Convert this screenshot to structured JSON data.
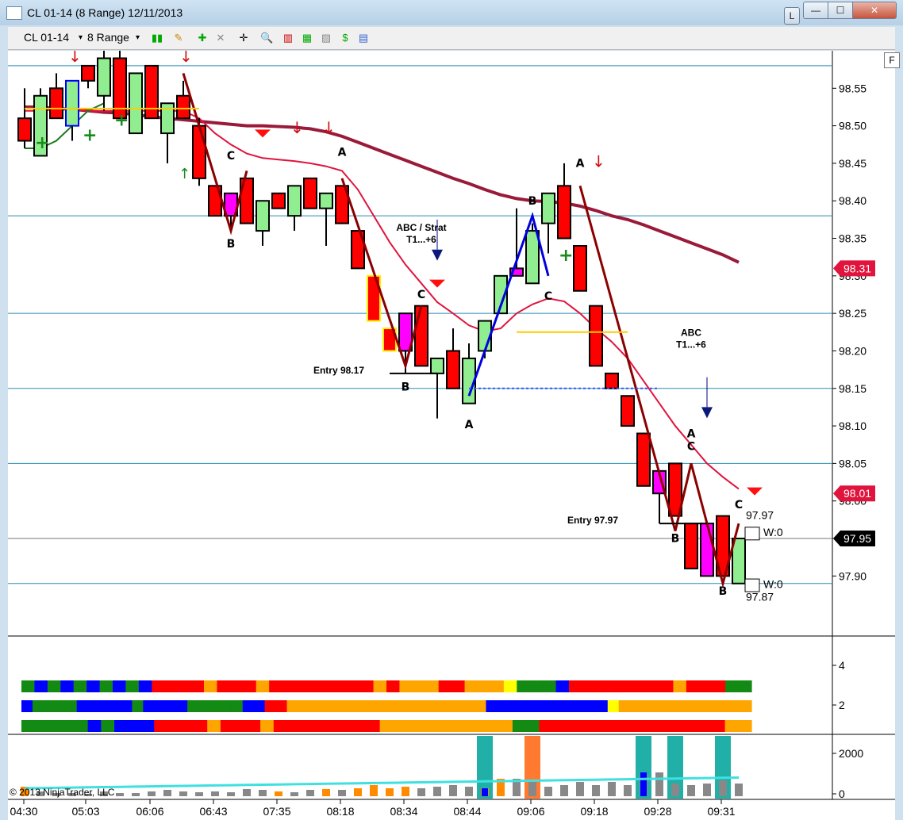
{
  "window": {
    "title": "CL 01-14 (8 Range)  12/11/2013",
    "buttons": {
      "l": "L",
      "min": "—",
      "max": "☐",
      "close": "✕"
    },
    "frame_color": "#b9d2e8"
  },
  "toolbar": {
    "instrument": "CL 01-14",
    "period": "8 Range",
    "icons": [
      "bar-style-icon",
      "pencil-draw-icon",
      "zoom-in-icon",
      "zoom-out-icon",
      "crosshair-icon",
      "magnifier-icon",
      "indicators-icon",
      "strategies-icon",
      "dollar-icon",
      "properties-icon"
    ]
  },
  "chart_data": {
    "type": "candlestick",
    "ylim": [
      97.82,
      98.6
    ],
    "yticks": [
      "98.55",
      "98.50",
      "98.45",
      "98.40",
      "98.35",
      "98.30",
      "98.25",
      "98.20",
      "98.15",
      "98.10",
      "98.05",
      "98.00",
      "97.95",
      "97.90"
    ],
    "xticks": [
      "04:30",
      "05:03",
      "06:06",
      "06:43",
      "07:35",
      "08:18",
      "08:34",
      "08:44",
      "09:06",
      "09:18",
      "09:28",
      "09:31"
    ],
    "price_labels": [
      {
        "text": "98.31",
        "value": 98.31,
        "color": "#e0143c"
      },
      {
        "text": "98.01",
        "value": 98.01,
        "color": "#e0143c"
      },
      {
        "text": "97.95",
        "value": 97.95,
        "color": "#000000"
      }
    ],
    "candles": [
      {
        "o": 98.48,
        "h": 98.55,
        "l": 98.47,
        "c": 98.51,
        "col": "red"
      },
      {
        "o": 98.46,
        "h": 98.55,
        "l": 98.46,
        "c": 98.54,
        "col": "green"
      },
      {
        "o": 98.55,
        "h": 98.57,
        "l": 98.51,
        "c": 98.51,
        "col": "red"
      },
      {
        "o": 98.5,
        "h": 98.56,
        "l": 98.48,
        "c": 98.56,
        "col": "green",
        "outline": "blue"
      },
      {
        "o": 98.58,
        "h": 98.58,
        "l": 98.55,
        "c": 98.56,
        "col": "red"
      },
      {
        "o": 98.54,
        "h": 98.6,
        "l": 98.52,
        "c": 98.59,
        "col": "green"
      },
      {
        "o": 98.59,
        "h": 98.6,
        "l": 98.51,
        "c": 98.51,
        "col": "red"
      },
      {
        "o": 98.49,
        "h": 98.57,
        "l": 98.49,
        "c": 98.57,
        "col": "green"
      },
      {
        "o": 98.58,
        "h": 98.58,
        "l": 98.51,
        "c": 98.51,
        "col": "red"
      },
      {
        "o": 98.49,
        "h": 98.53,
        "l": 98.45,
        "c": 98.53,
        "col": "green"
      },
      {
        "o": 98.54,
        "h": 98.56,
        "l": 98.51,
        "c": 98.51,
        "col": "red"
      },
      {
        "o": 98.5,
        "h": 98.51,
        "l": 98.42,
        "c": 98.43,
        "col": "red"
      },
      {
        "o": 98.42,
        "h": 98.42,
        "l": 98.38,
        "c": 98.38,
        "col": "red"
      },
      {
        "o": 98.38,
        "h": 98.41,
        "l": 98.36,
        "c": 98.41,
        "col": "magenta"
      },
      {
        "o": 98.43,
        "h": 98.43,
        "l": 98.37,
        "c": 98.37,
        "col": "red"
      },
      {
        "o": 98.36,
        "h": 98.4,
        "l": 98.34,
        "c": 98.4,
        "col": "green"
      },
      {
        "o": 98.41,
        "h": 98.41,
        "l": 98.39,
        "c": 98.39,
        "col": "red"
      },
      {
        "o": 98.38,
        "h": 98.42,
        "l": 98.36,
        "c": 98.42,
        "col": "green"
      },
      {
        "o": 98.43,
        "h": 98.43,
        "l": 98.39,
        "c": 98.39,
        "col": "red"
      },
      {
        "o": 98.39,
        "h": 98.41,
        "l": 98.34,
        "c": 98.41,
        "col": "green"
      },
      {
        "o": 98.42,
        "h": 98.42,
        "l": 98.37,
        "c": 98.37,
        "col": "red"
      },
      {
        "o": 98.36,
        "h": 98.36,
        "l": 98.31,
        "c": 98.31,
        "col": "red"
      },
      {
        "o": 98.3,
        "h": 98.3,
        "l": 98.24,
        "c": 98.24,
        "col": "red",
        "outline": "yellow"
      },
      {
        "o": 98.23,
        "h": 98.23,
        "l": 98.2,
        "c": 98.2,
        "col": "red",
        "outline": "yellow"
      },
      {
        "o": 98.2,
        "h": 98.25,
        "l": 98.17,
        "c": 98.25,
        "col": "magenta"
      },
      {
        "o": 98.26,
        "h": 98.26,
        "l": 98.18,
        "c": 98.18,
        "col": "red"
      },
      {
        "o": 98.17,
        "h": 98.19,
        "l": 98.11,
        "c": 98.19,
        "col": "green"
      },
      {
        "o": 98.2,
        "h": 98.23,
        "l": 98.15,
        "c": 98.15,
        "col": "red"
      },
      {
        "o": 98.13,
        "h": 98.21,
        "l": 98.13,
        "c": 98.19,
        "col": "green"
      },
      {
        "o": 98.2,
        "h": 98.24,
        "l": 98.19,
        "c": 98.24,
        "col": "green"
      },
      {
        "o": 98.25,
        "h": 98.3,
        "l": 98.25,
        "c": 98.3,
        "col": "green"
      },
      {
        "o": 98.3,
        "h": 98.39,
        "l": 98.3,
        "c": 98.31,
        "col": "magenta"
      },
      {
        "o": 98.29,
        "h": 98.37,
        "l": 98.29,
        "c": 98.36,
        "col": "green"
      },
      {
        "o": 98.37,
        "h": 98.41,
        "l": 98.33,
        "c": 98.41,
        "col": "green"
      },
      {
        "o": 98.42,
        "h": 98.45,
        "l": 98.35,
        "c": 98.35,
        "col": "red"
      },
      {
        "o": 98.34,
        "h": 98.34,
        "l": 98.28,
        "c": 98.28,
        "col": "red"
      },
      {
        "o": 98.26,
        "h": 98.26,
        "l": 98.18,
        "c": 98.18,
        "col": "red"
      },
      {
        "o": 98.17,
        "h": 98.17,
        "l": 98.15,
        "c": 98.15,
        "col": "red"
      },
      {
        "o": 98.14,
        "h": 98.14,
        "l": 98.1,
        "c": 98.1,
        "col": "red"
      },
      {
        "o": 98.09,
        "h": 98.09,
        "l": 98.02,
        "c": 98.02,
        "col": "red"
      },
      {
        "o": 98.01,
        "h": 98.04,
        "l": 97.97,
        "c": 98.04,
        "col": "magenta"
      },
      {
        "o": 98.05,
        "h": 98.05,
        "l": 97.98,
        "c": 97.98,
        "col": "red"
      },
      {
        "o": 97.97,
        "h": 97.97,
        "l": 97.91,
        "c": 97.91,
        "col": "red"
      },
      {
        "o": 97.9,
        "h": 97.97,
        "l": 97.9,
        "c": 97.97,
        "col": "magenta"
      },
      {
        "o": 97.98,
        "h": 97.98,
        "l": 97.9,
        "c": 97.9,
        "col": "red"
      },
      {
        "o": 97.89,
        "h": 97.95,
        "l": 97.89,
        "c": 97.95,
        "col": "green"
      }
    ],
    "ma_slow": [
      98.525,
      98.525,
      98.523,
      98.522,
      98.52,
      98.518,
      98.517,
      98.515,
      98.512,
      98.51,
      98.508,
      98.506,
      98.504,
      98.502,
      98.5,
      98.5,
      98.499,
      98.498,
      98.496,
      98.492,
      98.486,
      98.478,
      98.47,
      98.462,
      98.454,
      98.446,
      98.438,
      98.43,
      98.423,
      98.415,
      98.408,
      98.403,
      98.4,
      98.399,
      98.397,
      98.393,
      98.387,
      98.38,
      98.375,
      98.368,
      98.36,
      98.352,
      98.344,
      98.336,
      98.328,
      98.318
    ],
    "ma_fast": [
      98.52,
      98.52,
      98.522,
      98.522,
      98.52,
      98.52,
      98.52,
      98.52,
      98.52,
      98.52,
      98.52,
      98.51,
      98.49,
      98.475,
      98.463,
      98.457,
      98.455,
      98.453,
      98.45,
      98.446,
      98.44,
      98.415,
      98.38,
      98.345,
      98.315,
      98.29,
      98.265,
      98.25,
      98.234,
      98.226,
      98.23,
      98.25,
      98.262,
      98.27,
      98.266,
      98.25,
      98.23,
      98.212,
      98.19,
      98.16,
      98.13,
      98.1,
      98.075,
      98.05,
      98.032,
      98.016
    ],
    "ma_green": [
      98.47,
      98.47,
      98.48,
      98.5,
      98.52,
      98.53
    ],
    "horizontal_lines": [
      98.58,
      98.38,
      98.25,
      98.15,
      98.05,
      97.95,
      97.89
    ],
    "texts": [
      {
        "text": "A",
        "i": 9,
        "v": 98.605
      },
      {
        "text": "C",
        "i": 13,
        "v": 98.455
      },
      {
        "text": "B",
        "i": 13,
        "v": 98.338
      },
      {
        "text": "A",
        "i": 20,
        "v": 98.46
      },
      {
        "text": "C",
        "i": 25,
        "v": 98.27
      },
      {
        "text": "B",
        "i": 24,
        "v": 98.147
      },
      {
        "text": "A",
        "i": 28,
        "v": 98.097
      },
      {
        "text": "B",
        "i": 32,
        "v": 98.395
      },
      {
        "text": "C",
        "i": 33,
        "v": 98.268
      },
      {
        "text": "A",
        "i": 35,
        "v": 98.445
      },
      {
        "text": "A",
        "i": 42,
        "v": 98.085
      },
      {
        "text": "C",
        "i": 42,
        "v": 98.068
      },
      {
        "text": "B",
        "i": 41,
        "v": 97.945
      },
      {
        "text": "C",
        "i": 45,
        "v": 97.99
      },
      {
        "text": "B",
        "i": 44,
        "v": 97.875
      }
    ],
    "notes": [
      {
        "lines": [
          "ABC / Strat",
          "T1...+6"
        ],
        "i": 25,
        "v": 98.36
      },
      {
        "lines": [
          "ABC",
          "T1...+6"
        ],
        "i": 42,
        "v": 98.22
      },
      {
        "lines": [
          "Entry 98.17"
        ],
        "i": 21,
        "v": 98.17
      },
      {
        "lines": [
          "Entry 97.97"
        ],
        "i": 37,
        "v": 97.97
      }
    ],
    "box_labels": {
      "top": "97.97",
      "bottom": "97.87",
      "w_top": "W:0",
      "w_bottom": "W:0"
    },
    "panel2_yticks": [
      "4",
      "2"
    ],
    "panel3_yticks": [
      "2000",
      "0"
    ],
    "copyright": "© 2013 NinjaTrader, LLC"
  }
}
